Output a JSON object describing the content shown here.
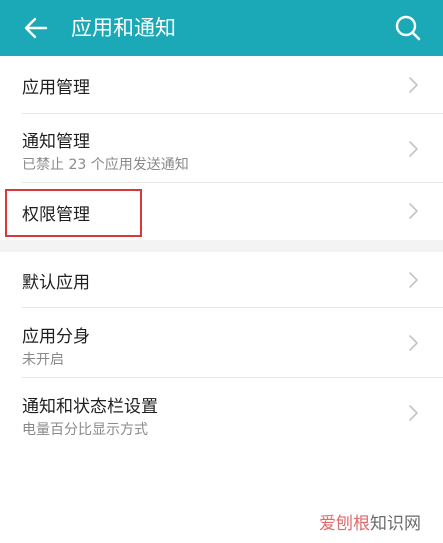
{
  "header": {
    "title": "应用和通知",
    "back_icon": "back-arrow-icon",
    "search_icon": "search-icon",
    "color": "#1ba8b7"
  },
  "section1": {
    "items": [
      {
        "label": "应用管理",
        "subtitle": ""
      },
      {
        "label": "通知管理",
        "subtitle": "已禁止 23 个应用发送通知"
      },
      {
        "label": "权限管理",
        "subtitle": ""
      }
    ]
  },
  "section2": {
    "items": [
      {
        "label": "默认应用",
        "subtitle": ""
      },
      {
        "label": "应用分身",
        "subtitle": "未开启"
      },
      {
        "label": "通知和状态栏设置",
        "subtitle": "电量百分比显示方式"
      }
    ]
  },
  "highlight_color": "#d9383b",
  "watermark": {
    "part1": "爱刨根",
    "part2": "知识网"
  }
}
